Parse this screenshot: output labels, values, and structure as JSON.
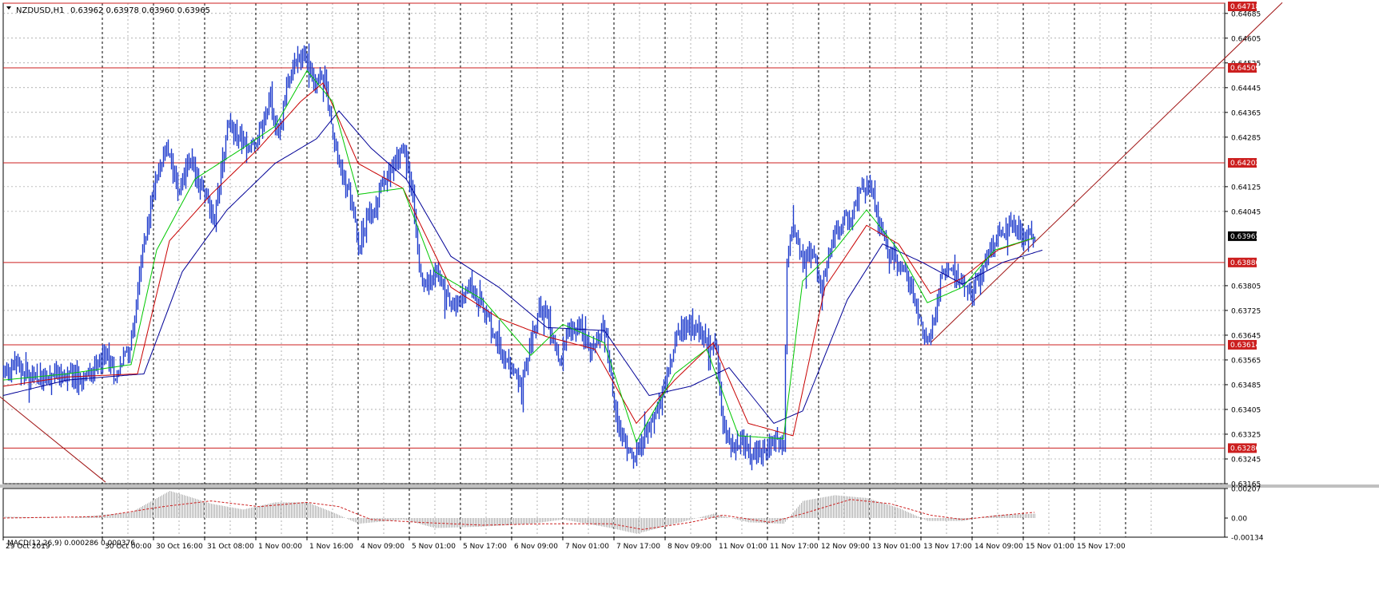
{
  "chart_data": [
    {
      "type": "candlestick",
      "title": "NZDUSD,H1",
      "ohlc_header": "0.63962 0.63978 0.63960 0.63965",
      "timeframe": "H1",
      "ylim": [
        0.63165,
        0.64718
      ],
      "yticks": [
        "0.64685",
        "0.64605",
        "0.64525",
        "0.64445",
        "0.64365",
        "0.64285",
        "0.64125",
        "0.64045",
        "0.63805",
        "0.63725",
        "0.63645",
        "0.63565",
        "0.63485",
        "0.63405",
        "0.63325",
        "0.63245",
        "0.63165"
      ],
      "xticks": [
        "29 Oct 2019",
        "30 Oct 00:00",
        "30 Oct 16:00",
        "31 Oct 08:00",
        "1 Nov 00:00",
        "1 Nov 16:00",
        "4 Nov 09:00",
        "5 Nov 01:00",
        "5 Nov 17:00",
        "6 Nov 09:00",
        "7 Nov 01:00",
        "7 Nov 17:00",
        "8 Nov 09:00",
        "11 Nov 01:00",
        "11 Nov 17:00",
        "12 Nov 09:00",
        "13 Nov 01:00",
        "13 Nov 17:00",
        "14 Nov 09:00",
        "15 Nov 01:00",
        "15 Nov 17:00"
      ],
      "horizontal_levels": [
        {
          "value": 0.64718,
          "label": "0.64718"
        },
        {
          "value": 0.64509,
          "label": "0.64509"
        },
        {
          "value": 0.64202,
          "label": "0.64202"
        },
        {
          "value": 0.6388,
          "label": "0.63880"
        },
        {
          "value": 0.63614,
          "label": "0.63614"
        },
        {
          "value": 0.6328,
          "label": "0.63280"
        }
      ],
      "current_price": {
        "value": 0.63965,
        "label": "0.63965"
      },
      "close_path": [
        [
          0,
          0.6353
        ],
        [
          8,
          0.6355
        ],
        [
          18,
          0.635
        ],
        [
          30,
          0.6352
        ],
        [
          44,
          0.635
        ],
        [
          56,
          0.6352
        ],
        [
          64,
          0.6358
        ],
        [
          70,
          0.6351
        ],
        [
          80,
          0.6363
        ],
        [
          88,
          0.6395
        ],
        [
          96,
          0.6418
        ],
        [
          102,
          0.6424
        ],
        [
          110,
          0.6412
        ],
        [
          116,
          0.6421
        ],
        [
          124,
          0.6412
        ],
        [
          132,
          0.6402
        ],
        [
          140,
          0.6434
        ],
        [
          146,
          0.6428
        ],
        [
          154,
          0.6425
        ],
        [
          160,
          0.643
        ],
        [
          166,
          0.644
        ],
        [
          172,
          0.643
        ],
        [
          180,
          0.645
        ],
        [
          188,
          0.6455
        ],
        [
          194,
          0.6445
        ],
        [
          200,
          0.645
        ],
        [
          206,
          0.643
        ],
        [
          212,
          0.6416
        ],
        [
          218,
          0.6407
        ],
        [
          222,
          0.6392
        ],
        [
          228,
          0.6402
        ],
        [
          236,
          0.6412
        ],
        [
          244,
          0.642
        ],
        [
          250,
          0.6426
        ],
        [
          256,
          0.641
        ],
        [
          260,
          0.6388
        ],
        [
          264,
          0.638
        ],
        [
          270,
          0.6386
        ],
        [
          276,
          0.6377
        ],
        [
          284,
          0.6374
        ],
        [
          292,
          0.6381
        ],
        [
          298,
          0.6374
        ],
        [
          306,
          0.6366
        ],
        [
          312,
          0.6358
        ],
        [
          318,
          0.6354
        ],
        [
          324,
          0.6348
        ],
        [
          330,
          0.6362
        ],
        [
          336,
          0.6375
        ],
        [
          342,
          0.6366
        ],
        [
          348,
          0.6357
        ],
        [
          354,
          0.6365
        ],
        [
          360,
          0.6368
        ],
        [
          366,
          0.636
        ],
        [
          372,
          0.6365
        ],
        [
          376,
          0.6366
        ],
        [
          380,
          0.635
        ],
        [
          384,
          0.6335
        ],
        [
          388,
          0.633
        ],
        [
          394,
          0.6326
        ],
        [
          400,
          0.6329
        ],
        [
          406,
          0.6337
        ],
        [
          414,
          0.6348
        ],
        [
          420,
          0.6362
        ],
        [
          426,
          0.6368
        ],
        [
          432,
          0.6366
        ],
        [
          438,
          0.6365
        ],
        [
          442,
          0.6362
        ],
        [
          446,
          0.636
        ],
        [
          450,
          0.6335
        ],
        [
          456,
          0.6328
        ],
        [
          462,
          0.633
        ],
        [
          468,
          0.6325
        ],
        [
          474,
          0.6326
        ],
        [
          478,
          0.6329
        ],
        [
          482,
          0.633
        ],
        [
          488,
          0.633
        ],
        [
          490,
          0.639
        ],
        [
          494,
          0.64
        ],
        [
          500,
          0.6388
        ],
        [
          506,
          0.6392
        ],
        [
          512,
          0.638
        ],
        [
          518,
          0.6394
        ],
        [
          524,
          0.64
        ],
        [
          530,
          0.6404
        ],
        [
          536,
          0.641
        ],
        [
          542,
          0.6414
        ],
        [
          548,
          0.64
        ],
        [
          554,
          0.639
        ],
        [
          560,
          0.6388
        ],
        [
          566,
          0.6383
        ],
        [
          570,
          0.6375
        ],
        [
          574,
          0.6368
        ],
        [
          578,
          0.6362
        ],
        [
          582,
          0.637
        ],
        [
          588,
          0.6386
        ],
        [
          594,
          0.6384
        ],
        [
          600,
          0.6382
        ],
        [
          606,
          0.6379
        ],
        [
          612,
          0.6384
        ],
        [
          618,
          0.6393
        ],
        [
          624,
          0.6398
        ],
        [
          630,
          0.64
        ],
        [
          636,
          0.6398
        ],
        [
          640,
          0.6396
        ],
        [
          645,
          0.6397
        ]
      ],
      "ma_fast_path": [
        [
          0,
          0.635
        ],
        [
          40,
          0.6352
        ],
        [
          80,
          0.6355
        ],
        [
          96,
          0.6392
        ],
        [
          120,
          0.6415
        ],
        [
          150,
          0.6425
        ],
        [
          170,
          0.6432
        ],
        [
          190,
          0.645
        ],
        [
          206,
          0.644
        ],
        [
          222,
          0.641
        ],
        [
          250,
          0.6412
        ],
        [
          270,
          0.6385
        ],
        [
          300,
          0.6376
        ],
        [
          330,
          0.6358
        ],
        [
          350,
          0.6368
        ],
        [
          376,
          0.6362
        ],
        [
          396,
          0.633
        ],
        [
          420,
          0.6352
        ],
        [
          440,
          0.636
        ],
        [
          460,
          0.6332
        ],
        [
          488,
          0.6331
        ],
        [
          500,
          0.6382
        ],
        [
          520,
          0.6392
        ],
        [
          540,
          0.6405
        ],
        [
          560,
          0.6392
        ],
        [
          578,
          0.6375
        ],
        [
          600,
          0.638
        ],
        [
          620,
          0.6392
        ],
        [
          645,
          0.6396
        ]
      ],
      "ma_mid_path": [
        [
          0,
          0.6348
        ],
        [
          40,
          0.6351
        ],
        [
          84,
          0.6352
        ],
        [
          104,
          0.6395
        ],
        [
          130,
          0.641
        ],
        [
          160,
          0.6425
        ],
        [
          186,
          0.644
        ],
        [
          200,
          0.6446
        ],
        [
          222,
          0.642
        ],
        [
          250,
          0.6412
        ],
        [
          280,
          0.638
        ],
        [
          310,
          0.637
        ],
        [
          340,
          0.6364
        ],
        [
          370,
          0.636
        ],
        [
          396,
          0.6336
        ],
        [
          420,
          0.635
        ],
        [
          444,
          0.6362
        ],
        [
          466,
          0.6336
        ],
        [
          494,
          0.6332
        ],
        [
          514,
          0.638
        ],
        [
          540,
          0.64
        ],
        [
          560,
          0.6394
        ],
        [
          580,
          0.6378
        ],
        [
          600,
          0.6383
        ],
        [
          622,
          0.6392
        ],
        [
          645,
          0.6396
        ]
      ],
      "ma_slow_path": [
        [
          0,
          0.6345
        ],
        [
          40,
          0.635
        ],
        [
          88,
          0.6352
        ],
        [
          112,
          0.6385
        ],
        [
          140,
          0.6405
        ],
        [
          170,
          0.642
        ],
        [
          196,
          0.6428
        ],
        [
          210,
          0.6437
        ],
        [
          230,
          0.6425
        ],
        [
          252,
          0.6415
        ],
        [
          280,
          0.639
        ],
        [
          310,
          0.638
        ],
        [
          340,
          0.6367
        ],
        [
          376,
          0.6366
        ],
        [
          404,
          0.6345
        ],
        [
          430,
          0.6348
        ],
        [
          454,
          0.6354
        ],
        [
          482,
          0.6336
        ],
        [
          500,
          0.634
        ],
        [
          528,
          0.6376
        ],
        [
          550,
          0.6394
        ],
        [
          575,
          0.6388
        ],
        [
          600,
          0.6381
        ],
        [
          625,
          0.6388
        ],
        [
          650,
          0.6392
        ]
      ],
      "trendlines": [
        {
          "from": [
            -3,
            0.6345
          ],
          "to": [
            64,
            0.6317
          ]
        },
        {
          "from": [
            580,
            0.6362
          ],
          "to": [
            800,
            0.6472
          ]
        }
      ]
    },
    {
      "type": "macd",
      "title": "MACD(12,26,9) 0.000286 0.000376",
      "params": [
        12,
        26,
        9
      ],
      "macd_value": 0.000286,
      "signal_value": 0.000376,
      "ylim": [
        -0.00134,
        0.00207
      ],
      "yticks": [
        "0.00207",
        "0.00",
        "-0.00134"
      ],
      "macd_path": [
        [
          0,
          0.0001
        ],
        [
          40,
          0.0
        ],
        [
          80,
          0.0004
        ],
        [
          96,
          0.0014
        ],
        [
          104,
          0.0019
        ],
        [
          116,
          0.0015
        ],
        [
          130,
          0.001
        ],
        [
          150,
          0.0006
        ],
        [
          170,
          0.0011
        ],
        [
          190,
          0.0011
        ],
        [
          206,
          0.0004
        ],
        [
          222,
          -0.0004
        ],
        [
          250,
          -0.0001
        ],
        [
          270,
          -0.0007
        ],
        [
          300,
          -0.0006
        ],
        [
          330,
          -0.0004
        ],
        [
          350,
          -0.0001
        ],
        [
          380,
          -0.0007
        ],
        [
          396,
          -0.0011
        ],
        [
          420,
          -0.0004
        ],
        [
          444,
          0.0003
        ],
        [
          466,
          -0.0003
        ],
        [
          488,
          -0.0004
        ],
        [
          500,
          0.0012
        ],
        [
          520,
          0.0016
        ],
        [
          540,
          0.0014
        ],
        [
          560,
          0.0007
        ],
        [
          578,
          -0.0002
        ],
        [
          600,
          -0.0002
        ],
        [
          620,
          0.0002
        ],
        [
          645,
          0.0003
        ]
      ],
      "signal_path": [
        [
          0,
          0.0
        ],
        [
          60,
          0.0001
        ],
        [
          100,
          0.0008
        ],
        [
          130,
          0.0012
        ],
        [
          160,
          0.0008
        ],
        [
          190,
          0.0011
        ],
        [
          210,
          0.0008
        ],
        [
          230,
          -0.0001
        ],
        [
          260,
          -0.0003
        ],
        [
          300,
          -0.0005
        ],
        [
          340,
          -0.0004
        ],
        [
          380,
          -0.0004
        ],
        [
          400,
          -0.0008
        ],
        [
          430,
          -0.0003
        ],
        [
          450,
          0.0002
        ],
        [
          480,
          -0.0003
        ],
        [
          500,
          0.0003
        ],
        [
          530,
          0.0013
        ],
        [
          555,
          0.001
        ],
        [
          580,
          0.0002
        ],
        [
          600,
          -0.0001
        ],
        [
          625,
          0.0002
        ],
        [
          645,
          0.0004
        ]
      ]
    }
  ],
  "colors": {
    "candle": "#1f3ccc",
    "ma_fast": "#00c800",
    "ma_mid": "#c80000",
    "ma_slow": "#000096",
    "level_line": "#cc1f1f",
    "trend_line": "#a01414",
    "macd_hist": "#b0b0b0",
    "signal": "#cc1f1f",
    "grid": "#808080",
    "current_price_bg": "#000000"
  }
}
